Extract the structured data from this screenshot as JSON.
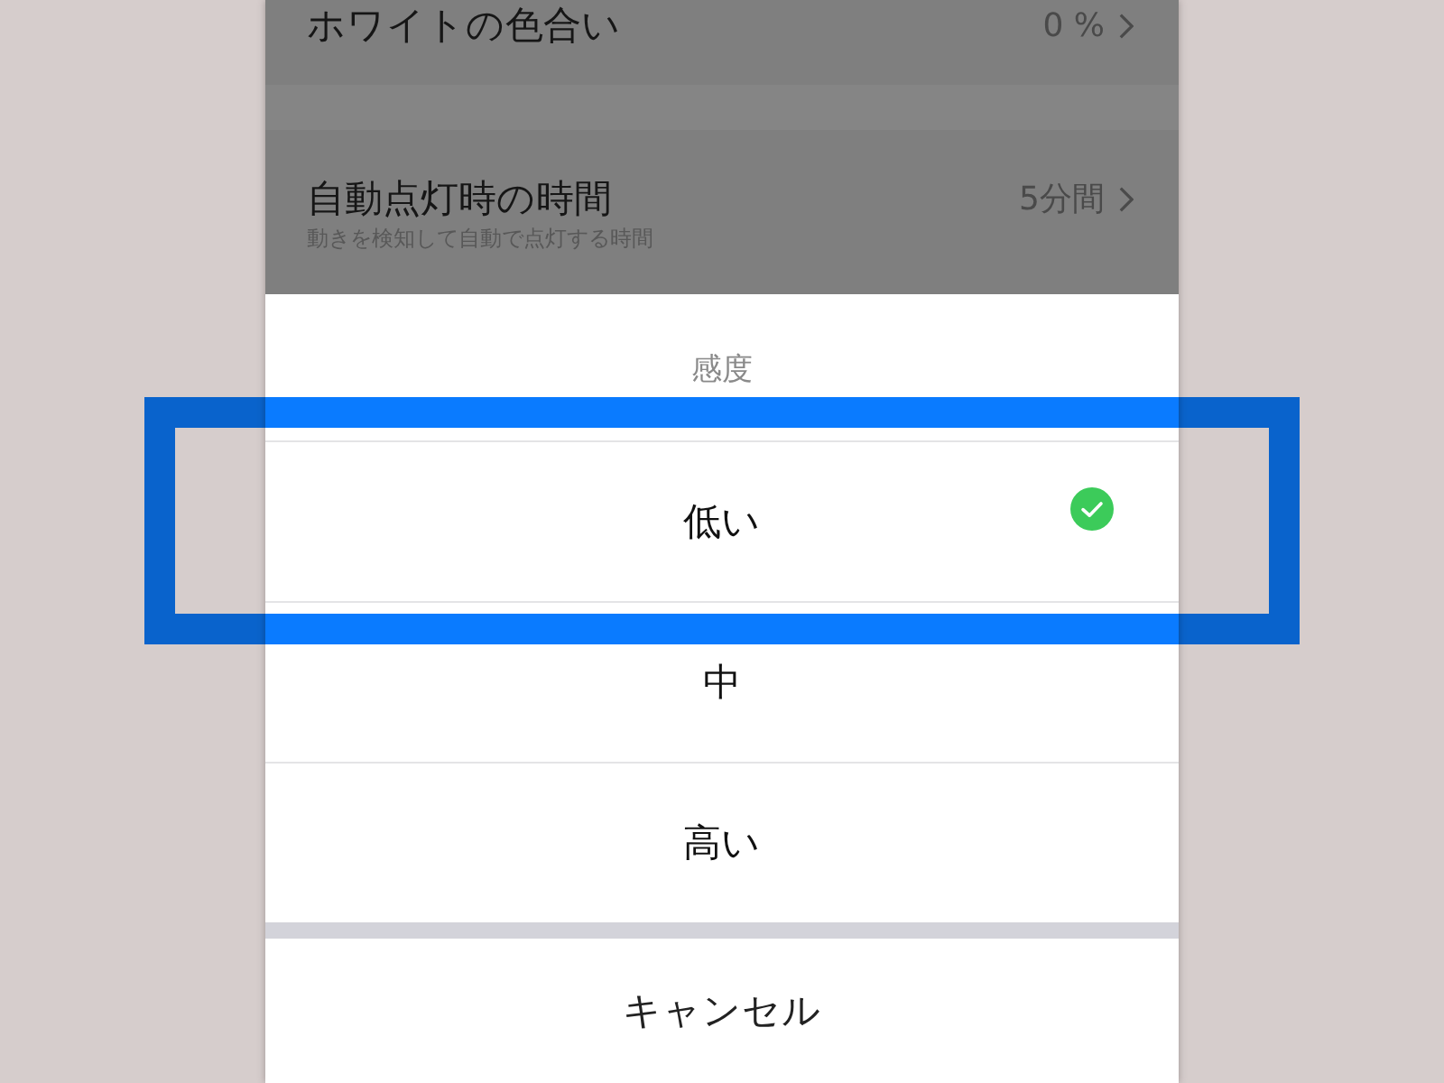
{
  "settings": [
    {
      "title": "ホワイトの色合い",
      "value": "0 %"
    },
    {
      "title": "自動点灯時の時間",
      "subtitle": "動きを検知して自動で点灯する時間",
      "value": "5分間"
    }
  ],
  "sheet": {
    "title": "感度",
    "options": [
      {
        "label": "低い",
        "selected": true,
        "highlighted": true
      },
      {
        "label": "中",
        "selected": false,
        "highlighted": false
      },
      {
        "label": "高い",
        "selected": false,
        "highlighted": false
      }
    ],
    "cancel": "キャンセル"
  }
}
